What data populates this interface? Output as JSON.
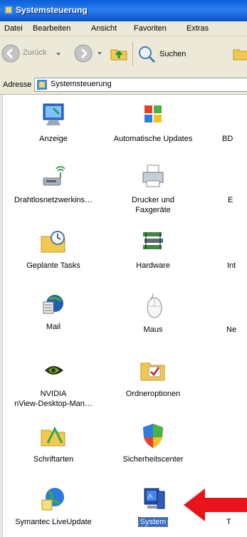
{
  "window": {
    "title": "Systemsteuerung"
  },
  "menu": {
    "items": [
      "Datei",
      "Bearbeiten",
      "Ansicht",
      "Favoriten",
      "Extras"
    ]
  },
  "toolbar": {
    "back_label": "Zurück",
    "search_label": "Suchen"
  },
  "address": {
    "label": "Adresse",
    "value": "Systemsteuerung"
  },
  "items": [
    {
      "label": "Anzeige",
      "icon": "display-icon"
    },
    {
      "label": "Automatische Updates",
      "icon": "windows-update-icon"
    },
    {
      "label": "BD",
      "icon": "generic-icon"
    },
    {
      "label": "Drahtlosnetzwerkins…",
      "icon": "wireless-network-icon"
    },
    {
      "label": "Drucker und",
      "label2": "Faxgeräte",
      "icon": "printer-icon"
    },
    {
      "label": "E",
      "icon": "generic-icon"
    },
    {
      "label": "Geplante Tasks",
      "icon": "scheduled-tasks-icon"
    },
    {
      "label": "Hardware",
      "icon": "hardware-icon"
    },
    {
      "label": "Int",
      "icon": "generic-icon"
    },
    {
      "label": "Mail",
      "icon": "mail-icon"
    },
    {
      "label": "Maus",
      "icon": "mouse-icon"
    },
    {
      "label": "Ne",
      "icon": "generic-icon"
    },
    {
      "label": "NVIDIA",
      "label2": "nView-Desktop-Man…",
      "icon": "nvidia-icon"
    },
    {
      "label": "Ordneroptionen",
      "icon": "folder-options-icon"
    },
    {
      "label": "Schriftarten",
      "icon": "fonts-icon"
    },
    {
      "label": "Sicherheitscenter",
      "icon": "security-center-icon"
    },
    {
      "label": "Symantec LiveUpdate",
      "icon": "liveupdate-icon"
    },
    {
      "label": "System",
      "icon": "system-icon",
      "selected": true
    },
    {
      "label": "T",
      "icon": "generic-icon"
    }
  ],
  "annotation": {
    "arrow_color": "#e8141a"
  }
}
